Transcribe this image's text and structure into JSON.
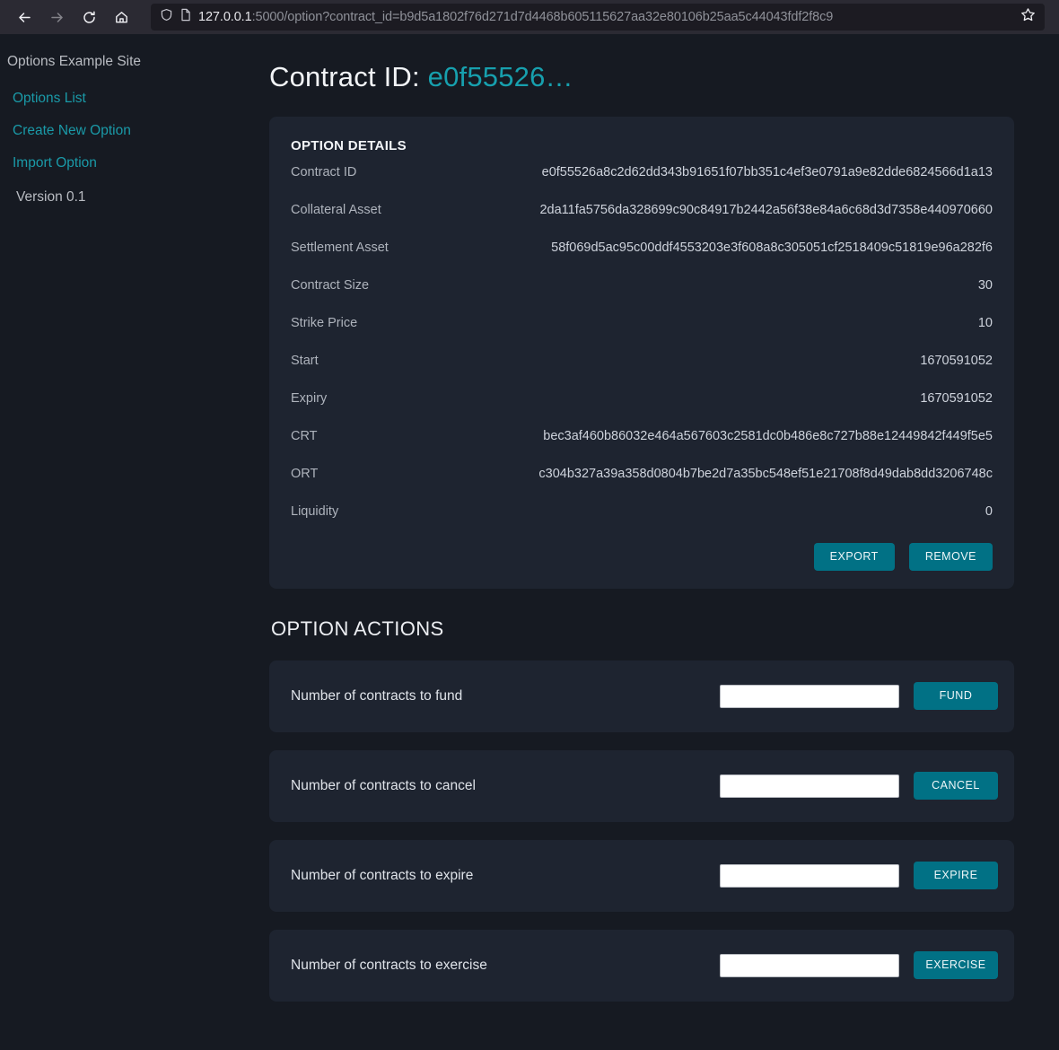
{
  "browser": {
    "back_icon": "back-arrow-icon",
    "forward_icon": "forward-arrow-icon",
    "reload_icon": "reload-icon",
    "home_icon": "home-icon",
    "shield_icon": "shield-icon",
    "page_icon": "page-document-icon",
    "bookmark_icon": "star-icon",
    "url_host": "127.0.0.1",
    "url_rest": ":5000/option?contract_id=b9d5a1802f76d271d7d4468b605115627aa32e80106b25aa5c44043fdf2f8c9"
  },
  "sidebar": {
    "brand": "Options Example Site",
    "items": [
      {
        "label": "Options List",
        "name": "sidebar-item-options-list"
      },
      {
        "label": "Create New Option",
        "name": "sidebar-item-create-new-option"
      },
      {
        "label": "Import Option",
        "name": "sidebar-item-import-option"
      }
    ],
    "version": "Version 0.1"
  },
  "header": {
    "title_prefix": "Contract ID:",
    "title_hash": "e0f55526…"
  },
  "details": {
    "card_title": "OPTION DETAILS",
    "rows": [
      {
        "label": "Contract ID",
        "value": "e0f55526a8c2d62dd343b91651f07bb351c4ef3e0791a9e82dde6824566d1a13"
      },
      {
        "label": "Collateral Asset",
        "value": "2da11fa5756da328699c90c84917b2442a56f38e84a6c68d3d7358e440970660"
      },
      {
        "label": "Settlement Asset",
        "value": "58f069d5ac95c00ddf4553203e3f608a8c305051cf2518409c51819e96a282f6"
      },
      {
        "label": "Contract Size",
        "value": "30"
      },
      {
        "label": "Strike Price",
        "value": "10"
      },
      {
        "label": "Start",
        "value": "1670591052"
      },
      {
        "label": "Expiry",
        "value": "1670591052"
      },
      {
        "label": "CRT",
        "value": "bec3af460b86032e464a567603c2581dc0b486e8c727b88e12449842f449f5e5"
      },
      {
        "label": "ORT",
        "value": "c304b327a39a358d0804b7be2d7a35bc548ef51e21708f8d49dab8dd3206748c"
      },
      {
        "label": "Liquidity",
        "value": "0"
      }
    ],
    "export_label": "EXPORT",
    "remove_label": "REMOVE"
  },
  "actions": {
    "section_title": "OPTION ACTIONS",
    "items": [
      {
        "label": "Number of contracts to fund",
        "value": "",
        "placeholder": "",
        "button": "FUND",
        "name": "fund"
      },
      {
        "label": "Number of contracts to cancel",
        "value": "",
        "placeholder": "",
        "button": "CANCEL",
        "name": "cancel"
      },
      {
        "label": "Number of contracts to expire",
        "value": "",
        "placeholder": "",
        "button": "EXPIRE",
        "name": "expire"
      },
      {
        "label": "Number of contracts to exercise",
        "value": "",
        "placeholder": "",
        "button": "EXERCISE",
        "name": "exercise"
      }
    ]
  },
  "colors": {
    "page_background": "#161a22",
    "card_background": "#1e2430",
    "accent_teal": "#017185",
    "link_teal": "#1a9aa8",
    "toolbar": "#2b2a33",
    "urlbar": "#1c1b22"
  }
}
